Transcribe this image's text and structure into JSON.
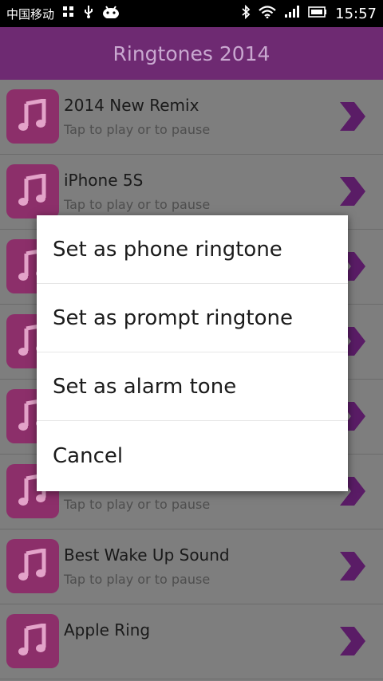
{
  "status": {
    "carrier": "中国移动",
    "time": "15:57"
  },
  "appbar": {
    "title": "Ringtones 2014"
  },
  "list": {
    "items": [
      {
        "title": "2014 New Remix",
        "subtitle": "Tap to play or to pause"
      },
      {
        "title": "iPhone 5S",
        "subtitle": "Tap to play or to pause"
      },
      {
        "title": "",
        "subtitle": ""
      },
      {
        "title": "",
        "subtitle": ""
      },
      {
        "title": "",
        "subtitle": ""
      },
      {
        "title": "",
        "subtitle": "Tap to play or to pause"
      },
      {
        "title": "Best Wake Up Sound",
        "subtitle": "Tap to play or to pause"
      },
      {
        "title": "Apple Ring",
        "subtitle": ""
      }
    ]
  },
  "dialog": {
    "options": [
      "Set as phone ringtone",
      "Set as prompt ringtone",
      "Set as alarm tone",
      "Cancel"
    ]
  },
  "colors": {
    "appbar": "#6e2a72",
    "accent": "#8a2aa0",
    "thumb": "#8c2f6a"
  }
}
